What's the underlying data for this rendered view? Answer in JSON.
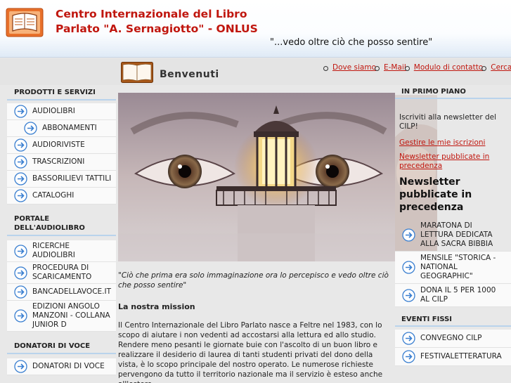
{
  "header": {
    "org_line1": "Centro Internazionale del Libro",
    "org_line2": "Parlato \"A. Sernagiotto\" - ONLUS",
    "tagline": "\"...vedo oltre ciò che posso sentire\""
  },
  "welcome": "Benvenuti",
  "toplinks": [
    "Dove siamo",
    "E-Mail",
    "Modulo di contatto",
    "Cerca"
  ],
  "left": {
    "products_title": "PRODOTTI E SERVIZI",
    "products": [
      "AUDIOLIBRI",
      "ABBONAMENTI",
      "AUDIORIVISTE",
      "TRASCRIZIONI",
      "BASSORILIEVI TATTILI",
      "CATALOGHI"
    ],
    "portal_title": "PORTALE DELL'AUDIOLIBRO",
    "portal": [
      "RICERCHE AUDIOLIBRI",
      "PROCEDURA DI SCARICAMENTO",
      "BANCADELLAVOCE.IT",
      "EDIZIONI ANGOLO MANZONI - COLLANA JUNIOR D"
    ],
    "donors_title": "DONATORI DI VOCE",
    "donors": [
      "DONATORI DI VOCE"
    ]
  },
  "center": {
    "quote": "\"Ciò che prima era solo immaginazione ora lo percepisco e vedo oltre ciò che posso sentire\"",
    "mission_title": "La nostra mission",
    "mission_body": "Il Centro Internazionale del Libro Parlato nasce a Feltre nel 1983, con lo scopo di aiutare i non vedenti ad accostarsi alla lettura ed allo studio. Rendere meno pesanti le giornate buie con l'ascolto di un buon libro e realizzare il desiderio di laurea di tanti studenti privati del dono della vista, è lo scopo principale del nostro operato. Le numerose richieste pervengono da tutto il territorio nazionale ma il servizio è esteso anche all'estero."
  },
  "right": {
    "primo_title": "IN PRIMO PIANO",
    "newsletter_text": "Iscriviti alla newsletter del CILP!",
    "link_manage": "Gestire le mie iscrizioni",
    "link_published": "Newsletter pubblicate in precedenza",
    "big_title": "Newsletter pubblicate in precedenza",
    "items": [
      "MARATONA DI LETTURA DEDICATA ALLA SACRA BIBBIA",
      "MENSILE \"STORICA - NATIONAL GEOGRAPHIC\"",
      "DONA IL 5 PER 1000 AL CILP"
    ],
    "eventi_title": "EVENTI FISSI",
    "eventi": [
      "CONVEGNO CILP",
      "FESTIVALETTERATURA"
    ]
  },
  "colors": {
    "brand_red": "#c0160e",
    "accent_blue": "#b9d3ec",
    "arrow_blue": "#3a7fd0"
  }
}
